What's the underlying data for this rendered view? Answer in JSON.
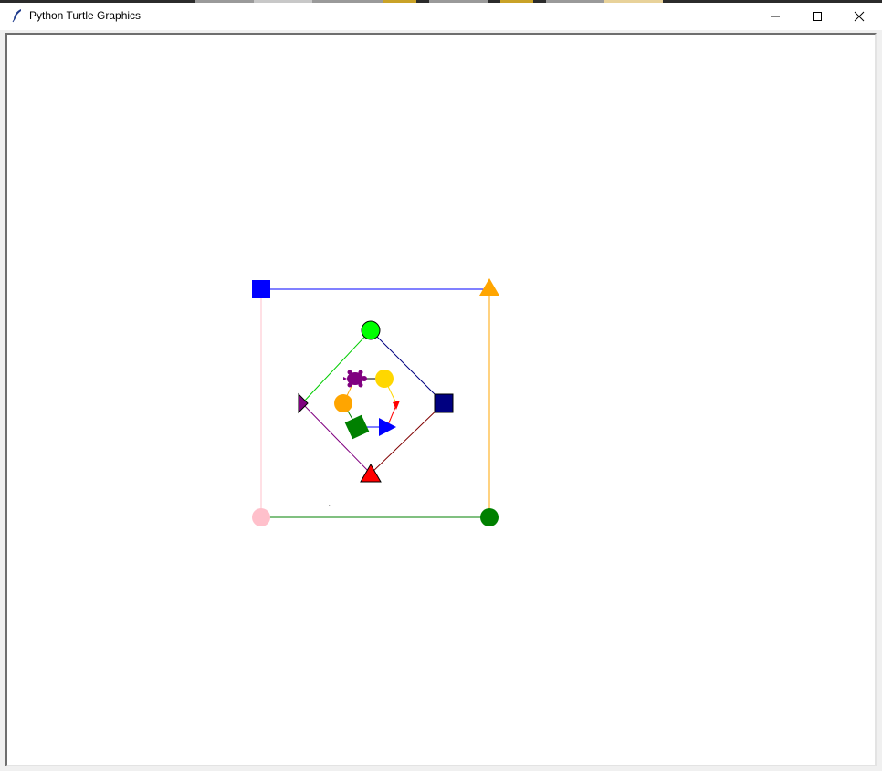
{
  "window": {
    "title": "Python Turtle Graphics",
    "app_icon": "feather-icon",
    "controls": {
      "minimize_icon": "minimize-icon",
      "maximize_icon": "maximize-icon",
      "close_icon": "close-icon"
    }
  },
  "canvas": {
    "background": "#ffffff",
    "dot_label": ".."
  },
  "colors": {
    "outer_top_line": "#0000ff",
    "outer_right_line": "#ffa500",
    "outer_bottom_line": "#008000",
    "outer_left_line": "#ffc0cb",
    "diamond_green_line": "#00cc00",
    "diamond_navy_line": "#000080",
    "diamond_red_line": "#ff0000",
    "diamond_purple_line": "#800080"
  },
  "turtles": [
    {
      "name": "outer-top-left",
      "shape": "square",
      "color": "#0000ff"
    },
    {
      "name": "outer-top-right",
      "shape": "triangle",
      "color": "#ffa500"
    },
    {
      "name": "outer-bottom-right",
      "shape": "circle",
      "color": "#008000"
    },
    {
      "name": "outer-bottom-left",
      "shape": "circle",
      "color": "#ffc0cb"
    },
    {
      "name": "diamond-top",
      "shape": "circle",
      "color": "#00ff00"
    },
    {
      "name": "diamond-right",
      "shape": "square",
      "color": "#000080"
    },
    {
      "name": "diamond-bottom",
      "shape": "triangle",
      "color": "#ff0000"
    },
    {
      "name": "diamond-left",
      "shape": "arrow",
      "color": "#800080"
    },
    {
      "name": "inner-turtle",
      "shape": "turtle",
      "color": "#800080"
    },
    {
      "name": "inner-yellow",
      "shape": "circle",
      "color": "#ffd700"
    },
    {
      "name": "inner-orange",
      "shape": "circle",
      "color": "#ffa500"
    },
    {
      "name": "inner-green",
      "shape": "square",
      "color": "#008000"
    },
    {
      "name": "inner-blue",
      "shape": "triangle",
      "color": "#0000ff"
    },
    {
      "name": "inner-red",
      "shape": "arrow",
      "color": "#ff0000"
    }
  ]
}
